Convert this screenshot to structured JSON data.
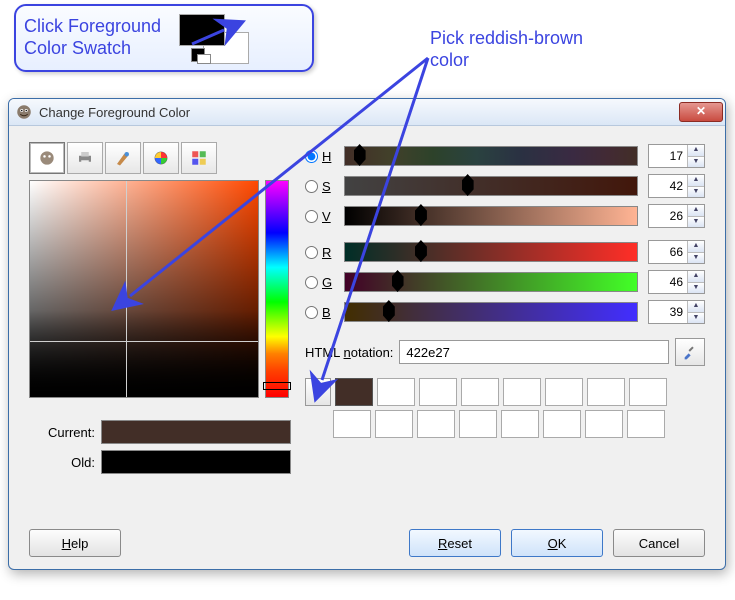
{
  "annotations": {
    "swatch_hint": "Click Foreground\nColor Swatch",
    "pick_hint": "Pick reddish-brown\ncolor"
  },
  "dialog": {
    "title": "Change Foreground Color",
    "tabs": [
      "gimp",
      "printer",
      "brush",
      "wheel",
      "palette"
    ],
    "active_tab": 0,
    "channels": {
      "H": {
        "value": 17,
        "selected": true
      },
      "S": {
        "value": 42,
        "selected": false
      },
      "V": {
        "value": 26,
        "selected": false
      },
      "R": {
        "value": 66,
        "selected": false
      },
      "G": {
        "value": 46,
        "selected": false
      },
      "B": {
        "value": 39,
        "selected": false
      }
    },
    "html_notation_label": "HTML notation:",
    "html_notation": "422e27",
    "current_label": "Current:",
    "old_label": "Old:",
    "current_color": "#422e27",
    "old_color": "#000000",
    "selected_hue": 17,
    "history": [
      "#422e27",
      "#ffffff",
      "#ffffff",
      "#ffffff",
      "#ffffff",
      "#ffffff",
      "#ffffff",
      "#ffffff"
    ],
    "history2": [
      "#ffffff",
      "#ffffff",
      "#ffffff",
      "#ffffff",
      "#ffffff",
      "#ffffff",
      "#ffffff",
      "#ffffff"
    ],
    "buttons": {
      "help": "Help",
      "reset": "Reset",
      "ok": "OK",
      "cancel": "Cancel"
    }
  }
}
